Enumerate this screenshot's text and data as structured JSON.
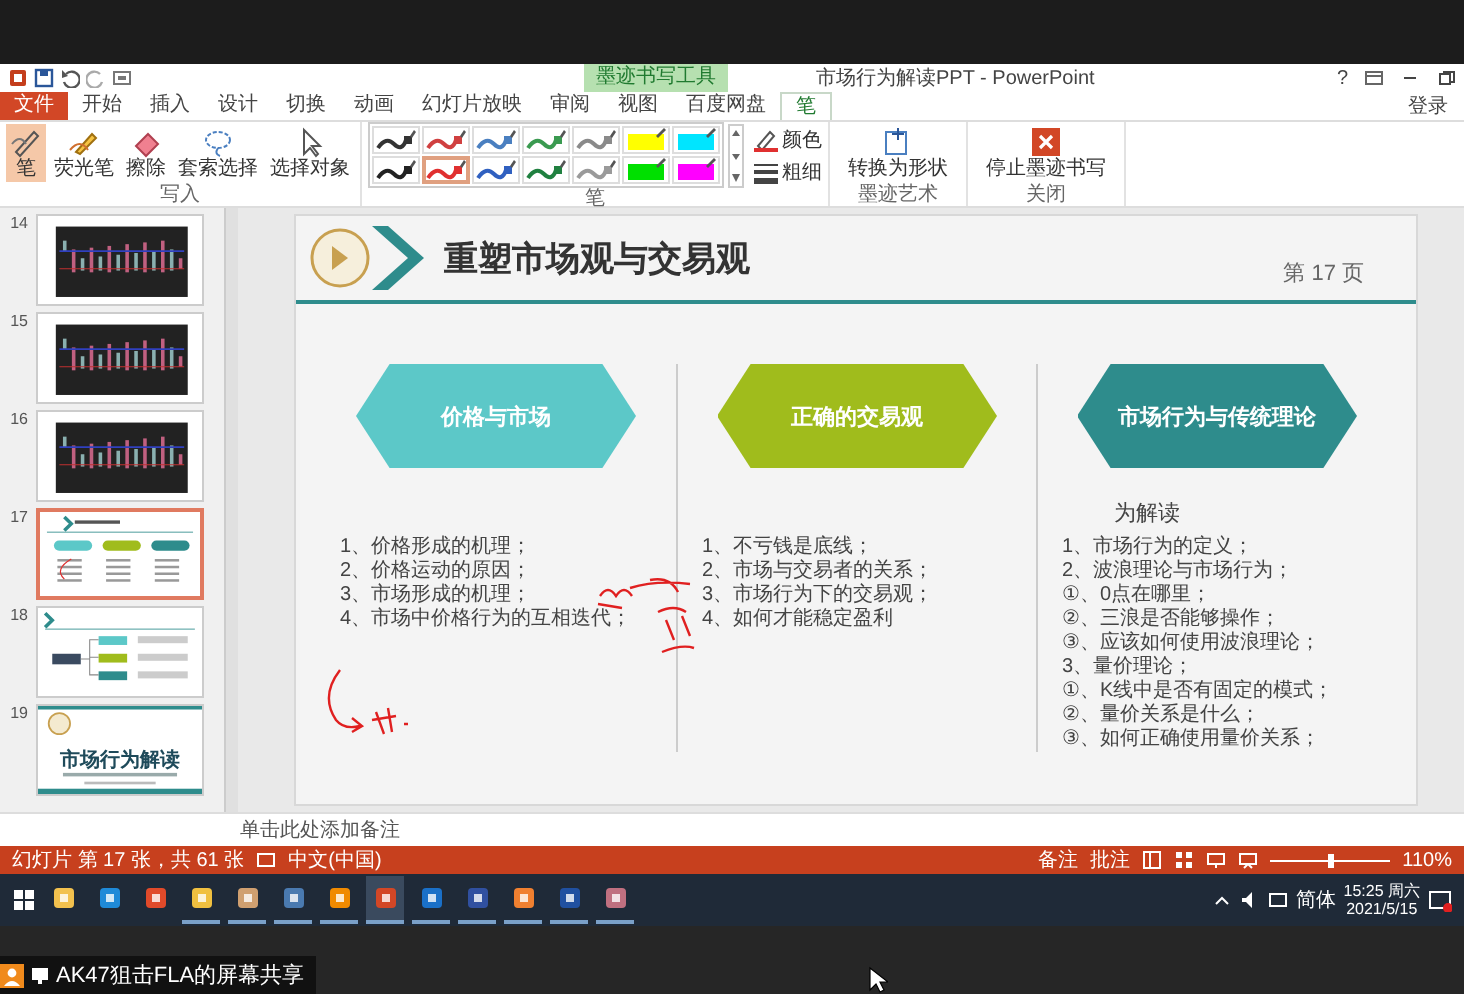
{
  "window": {
    "title": "市场行为解读PPT - PowerPoint",
    "context_tab": "墨迹书写工具",
    "sign_in": "登录",
    "help": "?"
  },
  "ribbon": {
    "tabs": [
      {
        "label": "文件",
        "kind": "file",
        "selected": false
      },
      {
        "label": "开始",
        "kind": "tab",
        "selected": false
      },
      {
        "label": "插入",
        "kind": "tab",
        "selected": false
      },
      {
        "label": "设计",
        "kind": "tab",
        "selected": false
      },
      {
        "label": "切换",
        "kind": "tab",
        "selected": false
      },
      {
        "label": "动画",
        "kind": "tab",
        "selected": false
      },
      {
        "label": "幻灯片放映",
        "kind": "tab",
        "selected": false
      },
      {
        "label": "审阅",
        "kind": "tab",
        "selected": false
      },
      {
        "label": "视图",
        "kind": "tab",
        "selected": false
      },
      {
        "label": "百度网盘",
        "kind": "tab",
        "selected": false
      },
      {
        "label": "笔",
        "kind": "context",
        "selected": true
      }
    ],
    "write_group": {
      "label": "写入",
      "tools": [
        {
          "label": "笔",
          "kind": "pen",
          "selected": true
        },
        {
          "label": "荧光笔",
          "kind": "highlighter",
          "selected": false
        },
        {
          "label": "擦除",
          "kind": "eraser",
          "selected": false
        },
        {
          "label": "套索选择",
          "kind": "lasso",
          "selected": false
        },
        {
          "label": "选择对象",
          "kind": "pointer",
          "selected": false
        }
      ]
    },
    "pens_group": {
      "label": "笔",
      "pens": [
        {
          "color": "#333333",
          "kind": "pen",
          "selected": false
        },
        {
          "color": "#d04040",
          "kind": "pen",
          "selected": false
        },
        {
          "color": "#4a7fc0",
          "kind": "pen",
          "selected": false
        },
        {
          "color": "#3a9a50",
          "kind": "pen",
          "selected": false
        },
        {
          "color": "#8a8a8a",
          "kind": "pen",
          "selected": false
        },
        {
          "color": "#ffff00",
          "kind": "marker",
          "selected": false
        },
        {
          "color": "#00e5ff",
          "kind": "marker",
          "selected": false
        },
        {
          "color": "#222222",
          "kind": "pen",
          "selected": false
        },
        {
          "color": "#e03030",
          "kind": "pen",
          "selected": true
        },
        {
          "color": "#3060c0",
          "kind": "pen",
          "selected": false
        },
        {
          "color": "#208040",
          "kind": "pen",
          "selected": false
        },
        {
          "color": "#9a9a9a",
          "kind": "pen",
          "selected": false
        },
        {
          "color": "#00e000",
          "kind": "marker",
          "selected": false
        },
        {
          "color": "#ff00ff",
          "kind": "marker",
          "selected": false
        }
      ],
      "options": [
        {
          "label": "颜色",
          "kind": "color"
        },
        {
          "label": "粗细",
          "kind": "weight"
        }
      ]
    },
    "art_group": {
      "label": "墨迹艺术",
      "button": "转换为形状"
    },
    "close_group": {
      "label": "关闭",
      "button": "停止墨迹书写"
    }
  },
  "thumbnails": [
    {
      "number": "14",
      "kind": "chart",
      "selected": false
    },
    {
      "number": "15",
      "kind": "chart",
      "selected": false
    },
    {
      "number": "16",
      "kind": "chart",
      "selected": false
    },
    {
      "number": "17",
      "kind": "columns",
      "selected": true
    },
    {
      "number": "18",
      "kind": "diagram",
      "selected": false
    },
    {
      "number": "19",
      "kind": "cover",
      "selected": false,
      "title": "市场行为解读"
    }
  ],
  "slide": {
    "title": "重塑市场观与交易观",
    "page": "第 17 页",
    "columns": [
      {
        "heading": "价格与市场",
        "color": "#5cc8c8",
        "items": [
          "1、价格形成的机理；",
          "2、价格运动的原因；",
          "3、市场形成的机理；",
          "4、市场中价格行为的互相迭代；"
        ]
      },
      {
        "heading": "正确的交易观",
        "color": "#a0bc1c",
        "items": [
          "1、不亏钱是底线；",
          "2、市场与交易者的关系；",
          "3、市场行为下的交易观；",
          "4、如何才能稳定盈利"
        ]
      },
      {
        "heading": "市场行为与传统理论",
        "color": "#2e8c8c",
        "subheading": "为解读",
        "items": [
          "1、市场行为的定义；",
          "2、波浪理论与市场行为；",
          "①、0点在哪里；",
          "②、三浪是否能够操作；",
          "③、应该如何使用波浪理论；",
          "3、量价理论；",
          "①、K线中是否有固定的模式；",
          "②、量价关系是什么；",
          "③、如何正确使用量价关系；"
        ]
      }
    ]
  },
  "notes": {
    "placeholder": "单击此处添加备注"
  },
  "status_bar": {
    "slide_info": "幻灯片 第 17 张，共 61 张",
    "language": "中文(中国)",
    "notes": "备注",
    "comments": "批注",
    "zoom": {
      "level": 0.5
    },
    "zoom_text": "110%"
  },
  "taskbar": {
    "apps": [
      {
        "running": false,
        "selected": false
      },
      {
        "running": false,
        "selected": false
      },
      {
        "running": false,
        "selected": false
      },
      {
        "running": true,
        "selected": false
      },
      {
        "running": true,
        "selected": false
      },
      {
        "running": true,
        "selected": false
      },
      {
        "running": true,
        "selected": false
      },
      {
        "running": true,
        "selected": true
      },
      {
        "running": true,
        "selected": false
      },
      {
        "running": true,
        "selected": false
      },
      {
        "running": true,
        "selected": false
      },
      {
        "running": true,
        "selected": false
      },
      {
        "running": true,
        "selected": false
      }
    ],
    "ime": "简体",
    "time": "15:25 周六",
    "date": "2021/5/15"
  },
  "share_label": "AK47狙击FLA的屏幕共享"
}
